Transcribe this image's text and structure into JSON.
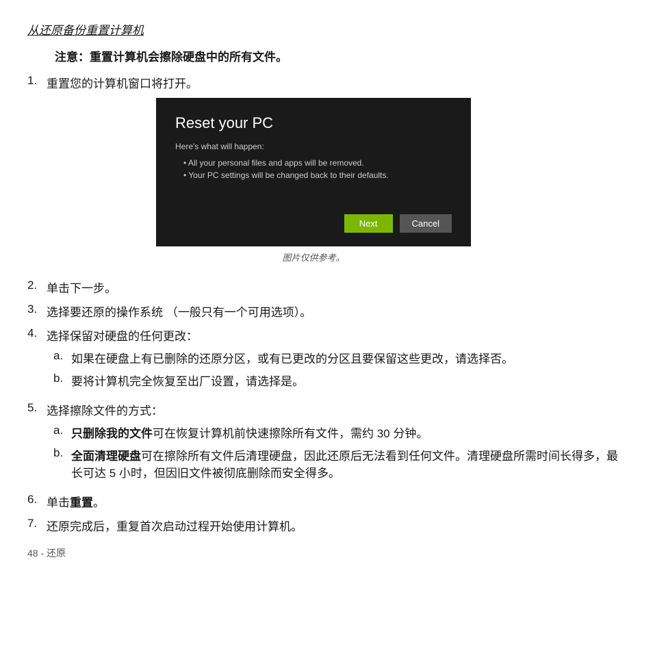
{
  "page": {
    "title": "从还原备份重置计算机",
    "warning": "注意：重置计算机会擦除硬盘中的所有文件。",
    "steps": [
      {
        "number": "1.",
        "text": "重置您的计算机窗口将打开。"
      },
      {
        "number": "2.",
        "text": "单击下一步。"
      },
      {
        "number": "3.",
        "text": "选择要还原的操作系统 （一般只有一个可用选项）。"
      },
      {
        "number": "4.",
        "text": "选择保留对硬盘的任何更改：",
        "substeps": [
          {
            "letter": "a.",
            "text": "如果在硬盘上有已删除的还原分区，或有已更改的分区且要保留这些更改，请选择否。"
          },
          {
            "letter": "b.",
            "text": "要将计算机完全恢复至出厂设置，请选择是。"
          }
        ]
      },
      {
        "number": "5.",
        "text": "选择擦除文件的方式：",
        "substeps": [
          {
            "letter": "a.",
            "bold_part": "只删除我的文件",
            "rest": "可在恢复计算机前快速擦除所有文件，需约 30 分钟。"
          },
          {
            "letter": "b.",
            "bold_part": "全面清理硬盘",
            "rest": "可在擦除所有文件后清理硬盘，因此还原后无法看到任何文件。清理硬盘所需时间长得多，最长可达 5 小时，但因旧文件被彻底删除而安全得多。"
          }
        ]
      },
      {
        "number": "6.",
        "text_before": "单击",
        "bold_part": "重置",
        "text_after": "。"
      },
      {
        "number": "7.",
        "text": "还原完成后，重复首次启动过程开始使用计算机。"
      }
    ],
    "dialog": {
      "title": "Reset your PC",
      "subtitle": "Here's what will happen:",
      "bullets": [
        "All your personal files and apps will be removed.",
        "Your PC settings will be changed back to their defaults."
      ],
      "next_btn": "Next",
      "cancel_btn": "Cancel"
    },
    "caption": "图片仅供参考。",
    "footer": "48 - 还原"
  }
}
